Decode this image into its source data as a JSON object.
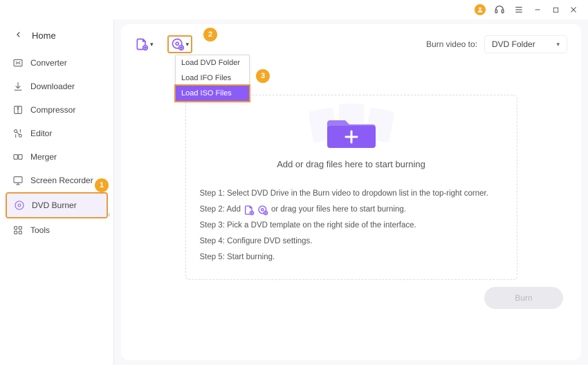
{
  "titlebar": {
    "icons": {
      "avatar": "user-avatar",
      "support": "support-icon",
      "menu": "hamburger-icon",
      "min": "minimize",
      "max": "maximize",
      "close": "close"
    }
  },
  "sidebar": {
    "home": "Home",
    "items": [
      {
        "label": "Converter"
      },
      {
        "label": "Downloader"
      },
      {
        "label": "Compressor"
      },
      {
        "label": "Editor"
      },
      {
        "label": "Merger"
      },
      {
        "label": "Screen Recorder"
      },
      {
        "label": "DVD Burner"
      },
      {
        "label": "Tools"
      }
    ]
  },
  "toolbar": {
    "burn_to_label": "Burn video to:",
    "burn_to_value": "DVD Folder"
  },
  "dvd_menu": {
    "items": [
      "Load DVD Folder",
      "Load IFO Files",
      "Load ISO Files"
    ]
  },
  "dropzone": {
    "text": "Add or drag files here to start burning"
  },
  "steps": {
    "s1a": "Step 1: Select DVD Drive in the Burn video to dropdown list in the top-right corner.",
    "s2a": "Step 2: Add",
    "s2b": "or drag your files here to start burning.",
    "s3": "Step 3: Pick a DVD template on the right side of the interface.",
    "s4": "Step 4: Configure DVD settings.",
    "s5": "Step 5: Start burning."
  },
  "footer": {
    "burn": "Burn"
  },
  "markers": {
    "m1": "1",
    "m2": "2",
    "m3": "3"
  }
}
